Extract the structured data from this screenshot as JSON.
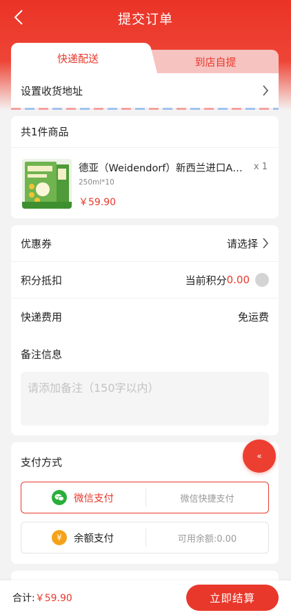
{
  "nav": {
    "title": "提交订单"
  },
  "delivery": {
    "tabs": [
      {
        "label": "快递配送"
      },
      {
        "label": "到店自提"
      }
    ],
    "address_label": "设置收货地址"
  },
  "goods": {
    "header": "共1件商品",
    "item": {
      "name": "德亚（Weidendorf）新西兰进口A…",
      "quantity": "x 1",
      "spec": "250ml*10",
      "price": "￥59.90"
    }
  },
  "info": {
    "coupon": {
      "label": "优惠券",
      "value": "请选择"
    },
    "points": {
      "label": "积分抵扣",
      "prefix": "当前积分",
      "value": "0.00"
    },
    "shipping": {
      "label": "快递费用",
      "value": "免运费"
    },
    "remark": {
      "label": "备注信息",
      "placeholder": "请添加备注（150字以内）"
    }
  },
  "payment": {
    "title": "支付方式",
    "options": [
      {
        "label": "微信支付",
        "desc": "微信快捷支付",
        "icon": "wechat-icon",
        "color": "#2aae3a"
      },
      {
        "label": "余额支付",
        "desc": "可用余额:0.00",
        "icon": "yen-icon",
        "color": "#f5a21b"
      }
    ]
  },
  "float_button": {
    "label": "«"
  },
  "footer": {
    "total_label": "合计:",
    "total_value": "￥59.90",
    "checkout_label": "立即结算"
  },
  "colors": {
    "accent": "#e8382b",
    "tab_inactive": "#f6c3c0"
  }
}
